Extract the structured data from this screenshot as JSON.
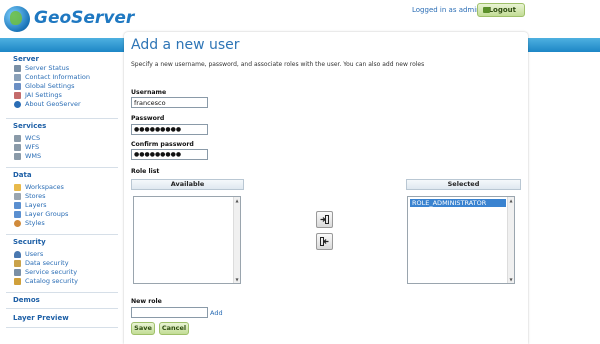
{
  "header": {
    "brand": "GeoServer",
    "login_text": "Logged in as admin.",
    "logout_label": "Logout"
  },
  "sidebar": {
    "sections": [
      {
        "title": "Server",
        "items": [
          {
            "label": "Server Status",
            "icon": "server-status-icon",
            "color": "#7a8fa5"
          },
          {
            "label": "Contact Information",
            "icon": "contact-icon",
            "color": "#8aa0b8"
          },
          {
            "label": "Global Settings",
            "icon": "settings-icon",
            "color": "#6b8fc4"
          },
          {
            "label": "JAI Settings",
            "icon": "jai-icon",
            "color": "#c46b6b"
          },
          {
            "label": "About GeoServer",
            "icon": "info-icon",
            "color": "#2a6db5"
          }
        ]
      },
      {
        "title": "Services",
        "items": [
          {
            "label": "WCS",
            "icon": "wcs-icon",
            "color": "#8a9aa8"
          },
          {
            "label": "WFS",
            "icon": "wfs-icon",
            "color": "#8a9aa8"
          },
          {
            "label": "WMS",
            "icon": "wms-icon",
            "color": "#8a9aa8"
          }
        ]
      },
      {
        "title": "Data",
        "items": [
          {
            "label": "Workspaces",
            "icon": "folder-icon",
            "color": "#e8b94a"
          },
          {
            "label": "Stores",
            "icon": "database-icon",
            "color": "#9aa5b0"
          },
          {
            "label": "Layers",
            "icon": "layers-icon",
            "color": "#5a8fd0"
          },
          {
            "label": "Layer Groups",
            "icon": "layer-groups-icon",
            "color": "#5a8fd0"
          },
          {
            "label": "Styles",
            "icon": "palette-icon",
            "color": "#d08a3a"
          }
        ]
      },
      {
        "title": "Security",
        "items": [
          {
            "label": "Users",
            "icon": "user-icon",
            "color": "#4a78b0"
          },
          {
            "label": "Data security",
            "icon": "data-security-icon",
            "color": "#c9a24a"
          },
          {
            "label": "Service security",
            "icon": "service-security-icon",
            "color": "#7a8fa5"
          },
          {
            "label": "Catalog security",
            "icon": "catalog-security-icon",
            "color": "#d0a03a"
          }
        ]
      },
      {
        "title": "Demos",
        "items": []
      },
      {
        "title": "Layer Preview",
        "items": []
      }
    ]
  },
  "main": {
    "title": "Add a new user",
    "description": "Specify a new username, password, and associate roles with the user. You can also add new roles",
    "username_label": "Username",
    "username_value": "francesco",
    "password_label": "Password",
    "password_value": "●●●●●●●●●",
    "confirm_label": "Confirm password",
    "confirm_value": "●●●●●●●●●",
    "role_list_label": "Role list",
    "available_header": "Available",
    "selected_header": "Selected",
    "selected_roles": [
      "ROLE_ADMINISTRATOR"
    ],
    "new_role_label": "New role",
    "new_role_value": "",
    "add_link": "Add",
    "save_label": "Save",
    "cancel_label": "Cancel"
  },
  "colors": {
    "accent": "#1f78c1",
    "band": "#1d86c6",
    "button_green": "#c2dc95",
    "selection": "#3a83d0"
  }
}
